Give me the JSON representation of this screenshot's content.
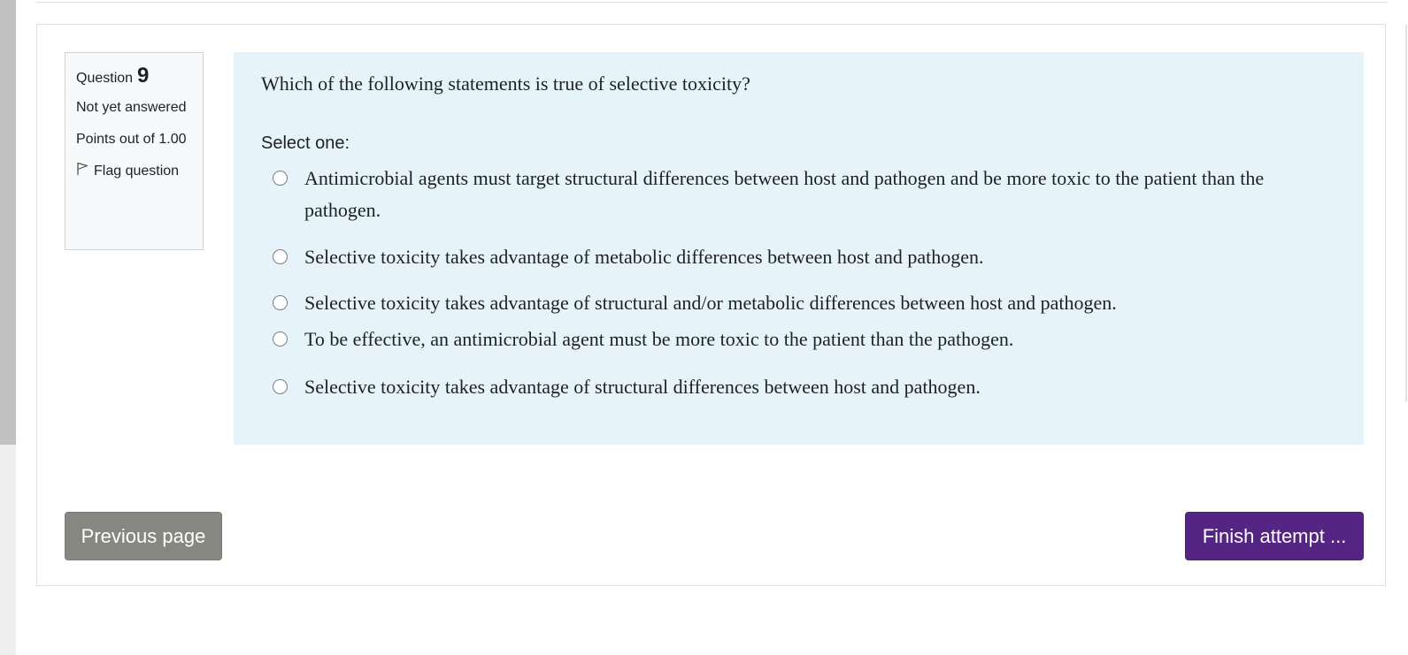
{
  "question": {
    "label": "Question",
    "number": "9",
    "state": "Not yet answered",
    "grade": "Points out of 1.00",
    "flag_label": "Flag question",
    "text": "Which of the following statements is true of selective toxicity?",
    "prompt": "Select one:",
    "options": [
      {
        "label": "Antimicrobial agents must target structural differences between host and pathogen and be more toxic to the patient than the pathogen.",
        "selected": false
      },
      {
        "label": "Selective toxicity takes advantage of metabolic differences between host and pathogen.",
        "selected": false
      },
      {
        "label": "Selective toxicity takes advantage of structural and/or metabolic differences between host and pathogen.",
        "selected": false
      },
      {
        "label": "To be effective, an antimicrobial agent must be more toxic to the patient than the pathogen.",
        "selected": false
      },
      {
        "label": "Selective toxicity takes advantage of structural differences between host and pathogen.",
        "selected": false
      }
    ]
  },
  "nav": {
    "previous_label": "Previous page",
    "finish_label": "Finish attempt ..."
  },
  "colors": {
    "content_bg": "#e7f3fa",
    "finish_button": "#552583",
    "previous_button": "#868781",
    "info_bg": "#f8f9fa"
  },
  "icons": {
    "flag": "flag-icon",
    "radio": "radio-unchecked-icon"
  }
}
